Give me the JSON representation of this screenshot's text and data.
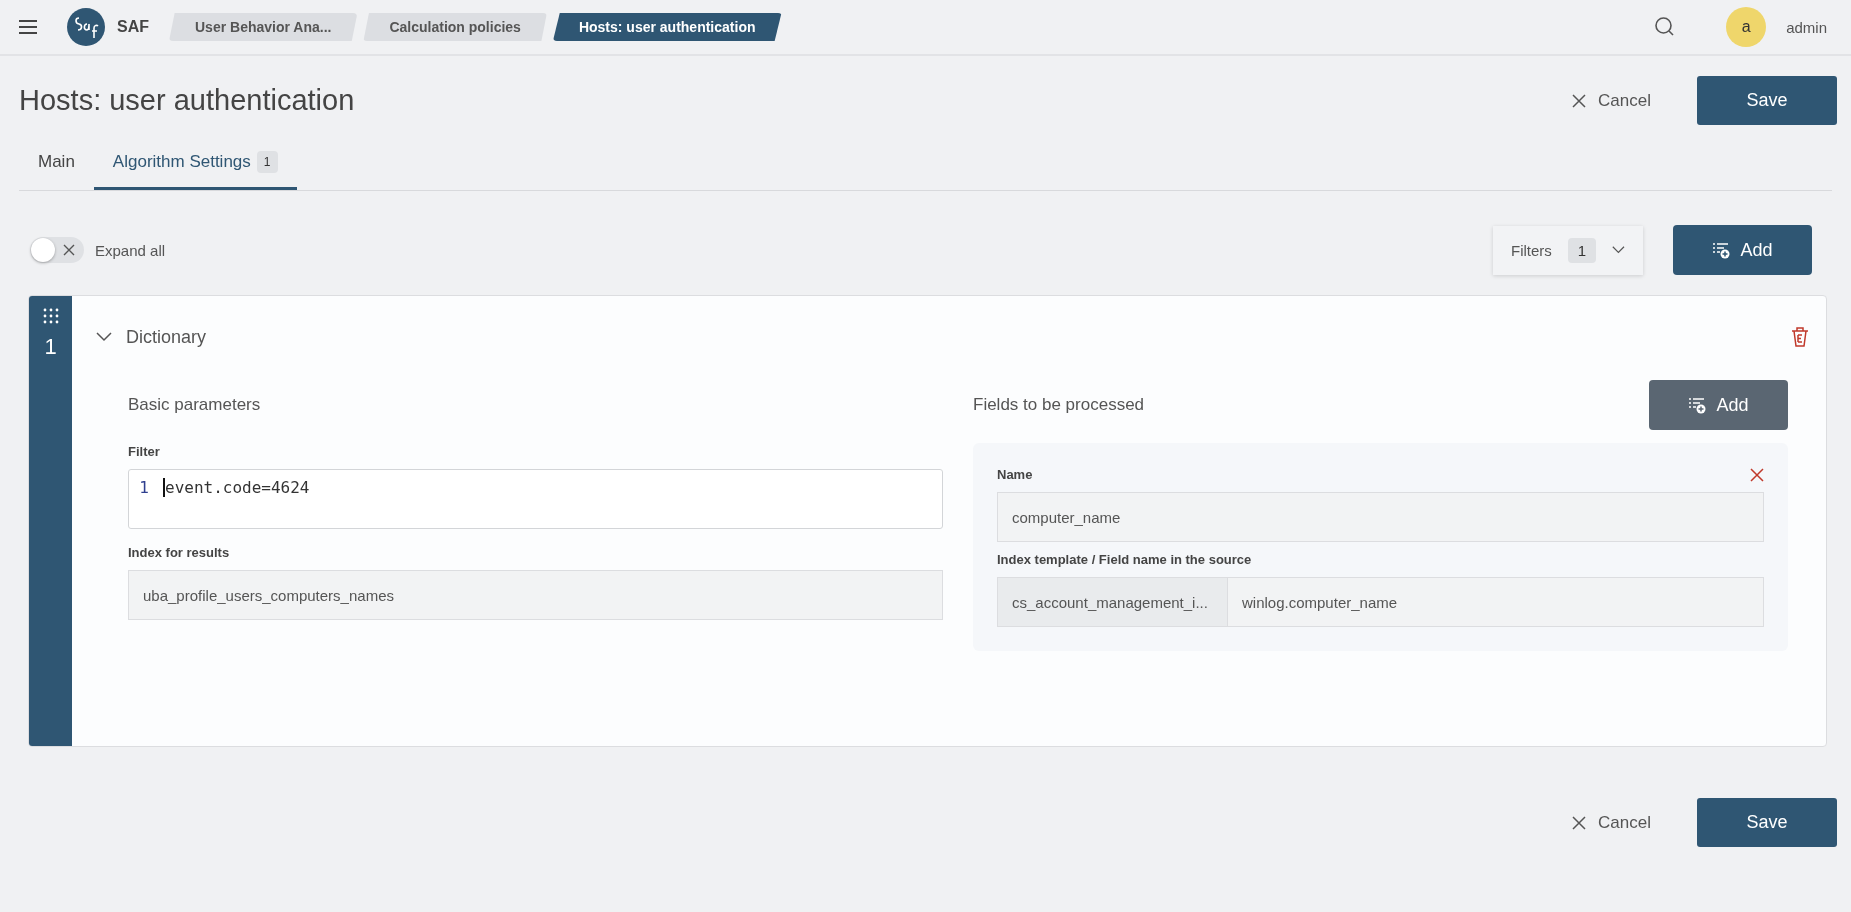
{
  "app": {
    "logo_text": "SAF"
  },
  "breadcrumbs": [
    {
      "label": "User Behavior Ana...",
      "selected": false
    },
    {
      "label": "Calculation policies",
      "selected": false
    },
    {
      "label": "Hosts: user authentication",
      "selected": true
    }
  ],
  "user": {
    "initial": "a",
    "name": "admin"
  },
  "page": {
    "title": "Hosts: user authentication",
    "cancel": "Cancel",
    "save": "Save"
  },
  "tabs": [
    {
      "label": "Main",
      "selected": false
    },
    {
      "label": "Algorithm Settings",
      "badge": "1",
      "selected": true
    }
  ],
  "expand_all": {
    "label": "Expand all",
    "on": false
  },
  "filters": {
    "label": "Filters",
    "count": "1"
  },
  "add_button": "Add",
  "items": [
    {
      "index": "1",
      "title": "Dictionary",
      "expanded": true,
      "basic": {
        "heading": "Basic parameters",
        "filter_label": "Filter",
        "filter_lines": [
          {
            "number": "1",
            "code": "event.code=4624"
          }
        ],
        "index_label": "Index for results",
        "index_value": "uba_profile_users_computers_names"
      },
      "fields": {
        "heading": "Fields to be processed",
        "add": "Add",
        "entries": [
          {
            "name_label": "Name",
            "name_value": "computer_name",
            "source_label": "Index template / Field name in the source",
            "template": "cs_account_management_i...",
            "field": "winlog.computer_name"
          }
        ]
      }
    }
  ],
  "footer": {
    "cancel": "Cancel",
    "save": "Save"
  }
}
